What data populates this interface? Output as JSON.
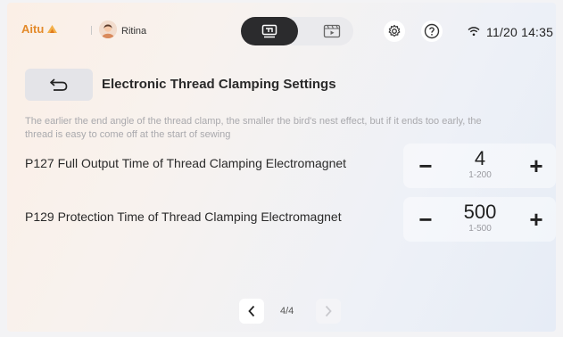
{
  "topbar": {
    "brand_name": "Aitu",
    "user_name": "Ritina",
    "modes": [
      {
        "icon": "sewing-machine-icon",
        "active": true
      },
      {
        "icon": "video-gallery-icon",
        "active": false
      }
    ],
    "settings_icon": "gear-icon",
    "help_icon": "help-icon",
    "wifi_icon": "wifi-icon",
    "datetime": "11/20 14:35"
  },
  "header": {
    "back_icon": "back-arrow-icon",
    "title": "Electronic Thread Clamping Settings"
  },
  "description": "The earlier the end angle of the thread clamp, the smaller the bird's nest effect, but if it ends too early, the thread is easy to come off at the start of sewing",
  "params": [
    {
      "label": "P127 Full Output Time of Thread Clamping Electromagnet",
      "value": "4",
      "range": "1-200",
      "minus": "−",
      "plus": "+"
    },
    {
      "label": "P129 Protection Time of Thread Clamping Electromagnet",
      "value": "500",
      "range": "1-500",
      "minus": "−",
      "plus": "+"
    }
  ],
  "pager": {
    "current_label": "4/4",
    "prev_enabled": true,
    "next_enabled": false
  },
  "colors": {
    "brand": "#e38a2a",
    "active_mode_bg": "#2b2b2d",
    "text_primary": "#2a2a2a",
    "text_muted": "#a9a9ad"
  }
}
